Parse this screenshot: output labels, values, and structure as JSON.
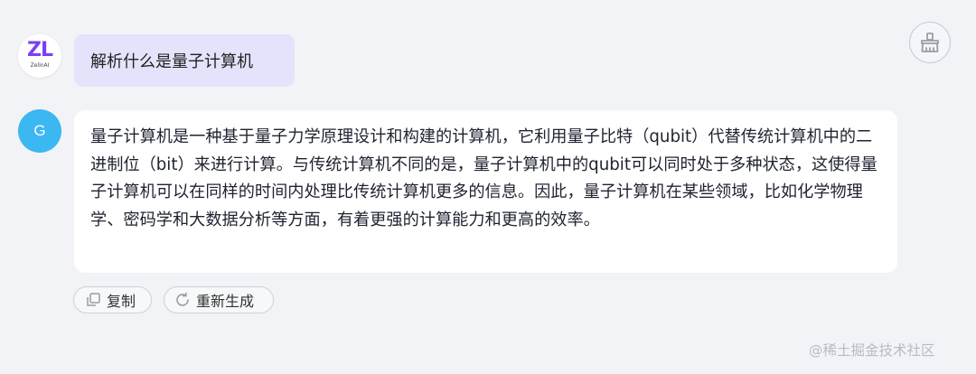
{
  "user_message": {
    "avatar": {
      "brand_mark": "ZL",
      "brand_name": "ZelinAI"
    },
    "text": "解析什么是量子计算机"
  },
  "clear_button": {
    "icon": "broom-icon"
  },
  "bot_message": {
    "avatar_letter": "G",
    "paragraph": "量子计算机是一种基于量子力学原理设计和构建的计算机，它利用量子比特（qubit）代替传统计算机中的二进制位（bit）来进行计算。与传统计算机不同的是，量子计算机中的qubit可以同时处于多种状态，这使得量子计算机可以在同样的时间内处理比传统计算机更多的信息。因此，量子计算机在某些领域，比如化学物理学、密码学和大数据分析等方面，有着更强的计算能力和更高的效率。"
  },
  "actions": {
    "copy_label": "复制",
    "regenerate_label": "重新生成"
  },
  "watermark": "@稀土掘金技术社区",
  "colors": {
    "background": "#f2f3f7",
    "user_bubble": "#e3e3fb",
    "bot_avatar": "#3bb7f2",
    "brand_purple": "#7b3ff2"
  }
}
